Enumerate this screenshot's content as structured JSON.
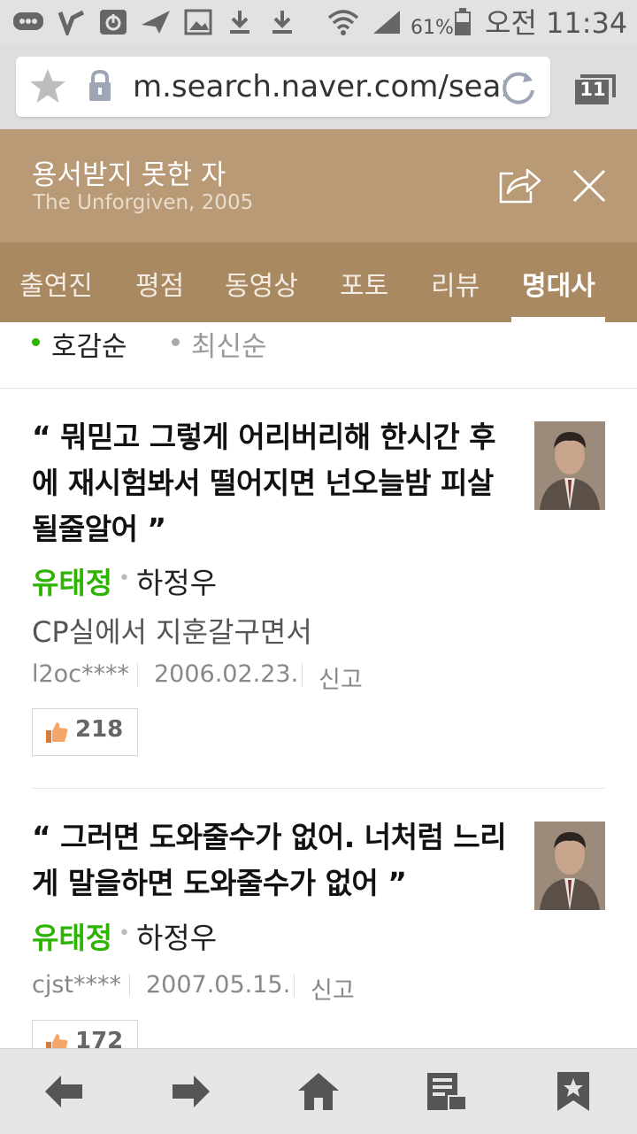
{
  "status_bar": {
    "battery": "61%",
    "time": "오전 11:34"
  },
  "browser": {
    "url": "m.search.naver.com/search",
    "tab_count": "11"
  },
  "movie": {
    "title": "용서받지 못한 자",
    "subtitle": "The Unforgiven, 2005"
  },
  "tabs": [
    {
      "label": "출연진"
    },
    {
      "label": "평점"
    },
    {
      "label": "동영상"
    },
    {
      "label": "포토"
    },
    {
      "label": "리뷰"
    },
    {
      "label": "명대사",
      "active": true
    }
  ],
  "filters": [
    {
      "label": "호감순",
      "active": true
    },
    {
      "label": "최신순",
      "active": false
    }
  ],
  "quotes": [
    {
      "text": "“ 뭐믿고 그렇게 어리버리해 한시간 후에 재시험봐서 떨어지면 넌오늘밤 피살될줄알어 ”",
      "role": "유태정",
      "actor": "하정우",
      "description": "CP실에서 지훈갈구면서",
      "user": "l2oc****",
      "date": "2006.02.23.",
      "report": "신고",
      "likes": "218"
    },
    {
      "text": "“ 그러면 도와줄수가 없어. 너처럼 느리게 말을하면 도와줄수가 없어 ”",
      "role": "유태정",
      "actor": "하정우",
      "description": "",
      "user": "cjst****",
      "date": "2007.05.15.",
      "report": "신고",
      "likes": "172"
    }
  ],
  "colors": {
    "header_bg": "#b99a76",
    "tabs_bg": "#a98962",
    "role_green": "#2db400",
    "filter_active_dot": "#2db400"
  },
  "icons": {
    "status": [
      "messenger-icon",
      "missed-call-icon",
      "power-icon",
      "send-icon",
      "image-icon",
      "download-icon",
      "download-icon",
      "wifi-icon",
      "signal-icon",
      "battery-icon"
    ],
    "browser": [
      "star-icon",
      "lock-icon",
      "refresh-icon",
      "tabs-icon"
    ],
    "header": [
      "share-icon",
      "close-icon"
    ],
    "bottom_nav": [
      "back-arrow-icon",
      "forward-arrow-icon",
      "home-icon",
      "reader-icon",
      "bookmark-icon"
    ]
  }
}
